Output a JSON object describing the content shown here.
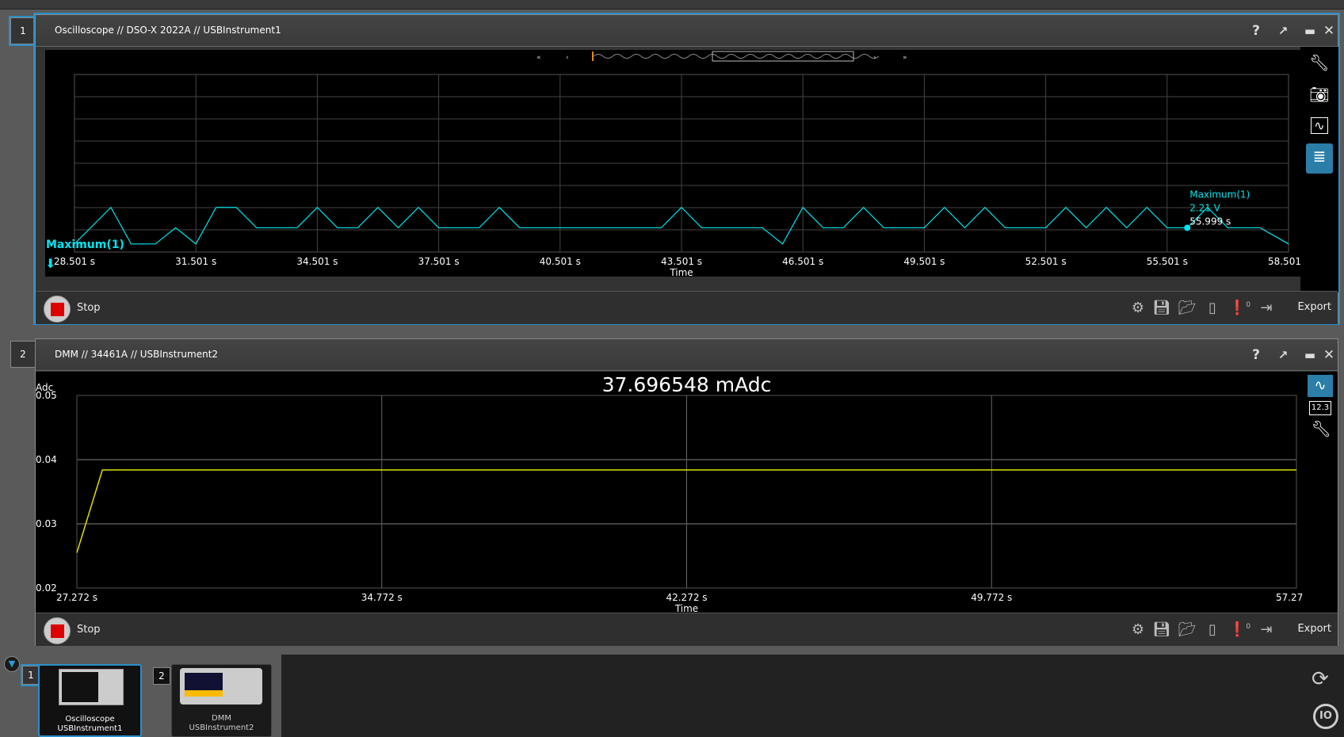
{
  "scope": {
    "number": "1",
    "title": "Oscilloscope // DSO-X 2022A // USBInstrument1",
    "stop_label": "Stop",
    "export_label": "Export",
    "alert_count": "0",
    "marker": {
      "label": "Maximum(1)",
      "value": "2.21 V",
      "time": "55.999 s"
    },
    "left_label": "Maximum(1)",
    "xlabel": "Time",
    "trace_color": "#00e5ee",
    "icons": [
      "help-icon",
      "popout-icon",
      "maximize-icon",
      "close-icon",
      "wrench-icon",
      "camera-icon",
      "waveform-icon",
      "database-icon",
      "gear-icon",
      "save-icon",
      "folder-icon",
      "device-icon",
      "alert-icon",
      "export-icon"
    ]
  },
  "dmm": {
    "number": "2",
    "title": "DMM // 34461A // USBInstrument2",
    "reading": "37.696548 mAdc",
    "stop_label": "Stop",
    "export_label": "Export",
    "alert_count": "0",
    "number_view_label": "12.3",
    "trace_color": "#e0e000"
  },
  "tray": {
    "cards": [
      {
        "number": "1",
        "line1": "Oscilloscope",
        "line2": "USBInstrument1",
        "selected": true
      },
      {
        "number": "2",
        "line1": "DMM",
        "line2": "USBInstrument2",
        "selected": false
      }
    ]
  },
  "chart_data": [
    {
      "type": "line",
      "xlabel": "Time",
      "xlim": [
        28.501,
        58.501
      ],
      "xticks": [
        "28.501 s",
        "31.501 s",
        "34.501 s",
        "37.501 s",
        "40.501 s",
        "43.501 s",
        "46.501 s",
        "49.501 s",
        "52.501 s",
        "55.501 s",
        "58.501 s"
      ],
      "ylim": [
        0,
        8.8
      ],
      "grid": true,
      "series": [
        {
          "x": [
            28.5,
            29.4,
            29.9,
            30.5,
            31.0,
            31.5,
            32.0,
            32.5,
            33.0,
            34.0,
            34.5,
            35.0,
            35.5,
            36.0,
            36.5,
            37.0,
            37.5,
            38.5,
            39.0,
            39.5,
            43.0,
            43.5,
            44.0,
            45.5,
            46.0,
            46.5,
            47.0,
            47.5,
            48.0,
            48.5,
            49.5,
            50.0,
            50.5,
            51.0,
            51.5,
            52.5,
            53.0,
            53.5,
            54.0,
            54.5,
            55.0,
            55.5,
            56.0,
            56.5,
            57.0,
            57.8,
            58.5
          ],
          "y": [
            0.4,
            2.21,
            0.4,
            0.4,
            1.2,
            0.4,
            2.21,
            2.21,
            1.2,
            1.2,
            2.21,
            1.2,
            1.2,
            2.21,
            1.2,
            2.21,
            1.2,
            1.2,
            2.21,
            1.2,
            1.2,
            2.21,
            1.2,
            1.2,
            0.4,
            2.21,
            1.2,
            1.2,
            2.21,
            1.2,
            1.2,
            2.21,
            1.2,
            2.21,
            1.2,
            1.2,
            2.21,
            1.2,
            2.21,
            1.2,
            2.21,
            1.2,
            1.2,
            2.21,
            1.2,
            1.2,
            0.4
          ]
        }
      ]
    },
    {
      "type": "line",
      "ylabel": "Adc",
      "xlabel": "Time",
      "xlim": [
        27.272,
        57.272
      ],
      "ylim": [
        0.02,
        0.05
      ],
      "xticks": [
        "27.272 s",
        "34.772 s",
        "42.272 s",
        "49.772 s",
        "57.272 s"
      ],
      "yticks": [
        "0.05",
        "0.04",
        "0.03",
        "0.02"
      ],
      "grid": true,
      "series": [
        {
          "x": [
            27.272,
            27.9,
            57.272
          ],
          "y": [
            0.0255,
            0.0384,
            0.0384
          ]
        }
      ]
    }
  ]
}
